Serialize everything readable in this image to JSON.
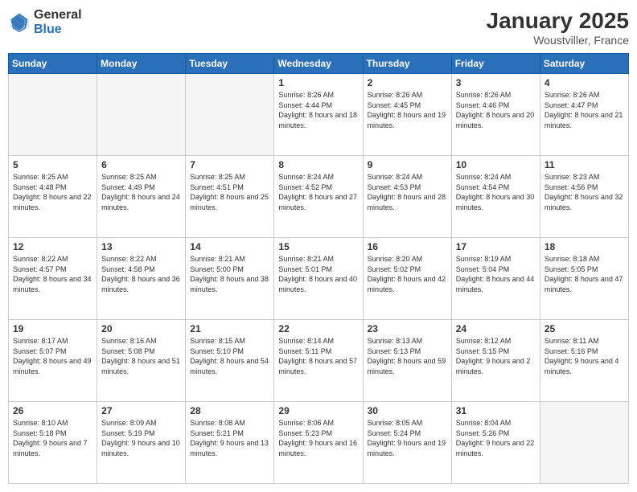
{
  "header": {
    "logo_general": "General",
    "logo_blue": "Blue",
    "month_title": "January 2025",
    "location": "Woustviller, France"
  },
  "days_of_week": [
    "Sunday",
    "Monday",
    "Tuesday",
    "Wednesday",
    "Thursday",
    "Friday",
    "Saturday"
  ],
  "weeks": [
    [
      {
        "day": "",
        "empty": true
      },
      {
        "day": "",
        "empty": true
      },
      {
        "day": "",
        "empty": true
      },
      {
        "day": "1",
        "sunrise": "Sunrise: 8:26 AM",
        "sunset": "Sunset: 4:44 PM",
        "daylight": "Daylight: 8 hours and 18 minutes."
      },
      {
        "day": "2",
        "sunrise": "Sunrise: 8:26 AM",
        "sunset": "Sunset: 4:45 PM",
        "daylight": "Daylight: 8 hours and 19 minutes."
      },
      {
        "day": "3",
        "sunrise": "Sunrise: 8:26 AM",
        "sunset": "Sunset: 4:46 PM",
        "daylight": "Daylight: 8 hours and 20 minutes."
      },
      {
        "day": "4",
        "sunrise": "Sunrise: 8:26 AM",
        "sunset": "Sunset: 4:47 PM",
        "daylight": "Daylight: 8 hours and 21 minutes."
      }
    ],
    [
      {
        "day": "5",
        "sunrise": "Sunrise: 8:25 AM",
        "sunset": "Sunset: 4:48 PM",
        "daylight": "Daylight: 8 hours and 22 minutes."
      },
      {
        "day": "6",
        "sunrise": "Sunrise: 8:25 AM",
        "sunset": "Sunset: 4:49 PM",
        "daylight": "Daylight: 8 hours and 24 minutes."
      },
      {
        "day": "7",
        "sunrise": "Sunrise: 8:25 AM",
        "sunset": "Sunset: 4:51 PM",
        "daylight": "Daylight: 8 hours and 25 minutes."
      },
      {
        "day": "8",
        "sunrise": "Sunrise: 8:24 AM",
        "sunset": "Sunset: 4:52 PM",
        "daylight": "Daylight: 8 hours and 27 minutes."
      },
      {
        "day": "9",
        "sunrise": "Sunrise: 8:24 AM",
        "sunset": "Sunset: 4:53 PM",
        "daylight": "Daylight: 8 hours and 28 minutes."
      },
      {
        "day": "10",
        "sunrise": "Sunrise: 8:24 AM",
        "sunset": "Sunset: 4:54 PM",
        "daylight": "Daylight: 8 hours and 30 minutes."
      },
      {
        "day": "11",
        "sunrise": "Sunrise: 8:23 AM",
        "sunset": "Sunset: 4:56 PM",
        "daylight": "Daylight: 8 hours and 32 minutes."
      }
    ],
    [
      {
        "day": "12",
        "sunrise": "Sunrise: 8:22 AM",
        "sunset": "Sunset: 4:57 PM",
        "daylight": "Daylight: 8 hours and 34 minutes."
      },
      {
        "day": "13",
        "sunrise": "Sunrise: 8:22 AM",
        "sunset": "Sunset: 4:58 PM",
        "daylight": "Daylight: 8 hours and 36 minutes."
      },
      {
        "day": "14",
        "sunrise": "Sunrise: 8:21 AM",
        "sunset": "Sunset: 5:00 PM",
        "daylight": "Daylight: 8 hours and 38 minutes."
      },
      {
        "day": "15",
        "sunrise": "Sunrise: 8:21 AM",
        "sunset": "Sunset: 5:01 PM",
        "daylight": "Daylight: 8 hours and 40 minutes."
      },
      {
        "day": "16",
        "sunrise": "Sunrise: 8:20 AM",
        "sunset": "Sunset: 5:02 PM",
        "daylight": "Daylight: 8 hours and 42 minutes."
      },
      {
        "day": "17",
        "sunrise": "Sunrise: 8:19 AM",
        "sunset": "Sunset: 5:04 PM",
        "daylight": "Daylight: 8 hours and 44 minutes."
      },
      {
        "day": "18",
        "sunrise": "Sunrise: 8:18 AM",
        "sunset": "Sunset: 5:05 PM",
        "daylight": "Daylight: 8 hours and 47 minutes."
      }
    ],
    [
      {
        "day": "19",
        "sunrise": "Sunrise: 8:17 AM",
        "sunset": "Sunset: 5:07 PM",
        "daylight": "Daylight: 8 hours and 49 minutes."
      },
      {
        "day": "20",
        "sunrise": "Sunrise: 8:16 AM",
        "sunset": "Sunset: 5:08 PM",
        "daylight": "Daylight: 8 hours and 51 minutes."
      },
      {
        "day": "21",
        "sunrise": "Sunrise: 8:15 AM",
        "sunset": "Sunset: 5:10 PM",
        "daylight": "Daylight: 8 hours and 54 minutes."
      },
      {
        "day": "22",
        "sunrise": "Sunrise: 8:14 AM",
        "sunset": "Sunset: 5:11 PM",
        "daylight": "Daylight: 8 hours and 57 minutes."
      },
      {
        "day": "23",
        "sunrise": "Sunrise: 8:13 AM",
        "sunset": "Sunset: 5:13 PM",
        "daylight": "Daylight: 8 hours and 59 minutes."
      },
      {
        "day": "24",
        "sunrise": "Sunrise: 8:12 AM",
        "sunset": "Sunset: 5:15 PM",
        "daylight": "Daylight: 9 hours and 2 minutes."
      },
      {
        "day": "25",
        "sunrise": "Sunrise: 8:11 AM",
        "sunset": "Sunset: 5:16 PM",
        "daylight": "Daylight: 9 hours and 4 minutes."
      }
    ],
    [
      {
        "day": "26",
        "sunrise": "Sunrise: 8:10 AM",
        "sunset": "Sunset: 5:18 PM",
        "daylight": "Daylight: 9 hours and 7 minutes."
      },
      {
        "day": "27",
        "sunrise": "Sunrise: 8:09 AM",
        "sunset": "Sunset: 5:19 PM",
        "daylight": "Daylight: 9 hours and 10 minutes."
      },
      {
        "day": "28",
        "sunrise": "Sunrise: 8:08 AM",
        "sunset": "Sunset: 5:21 PM",
        "daylight": "Daylight: 9 hours and 13 minutes."
      },
      {
        "day": "29",
        "sunrise": "Sunrise: 8:06 AM",
        "sunset": "Sunset: 5:23 PM",
        "daylight": "Daylight: 9 hours and 16 minutes."
      },
      {
        "day": "30",
        "sunrise": "Sunrise: 8:05 AM",
        "sunset": "Sunset: 5:24 PM",
        "daylight": "Daylight: 9 hours and 19 minutes."
      },
      {
        "day": "31",
        "sunrise": "Sunrise: 8:04 AM",
        "sunset": "Sunset: 5:26 PM",
        "daylight": "Daylight: 9 hours and 22 minutes."
      },
      {
        "day": "",
        "empty": true
      }
    ]
  ]
}
